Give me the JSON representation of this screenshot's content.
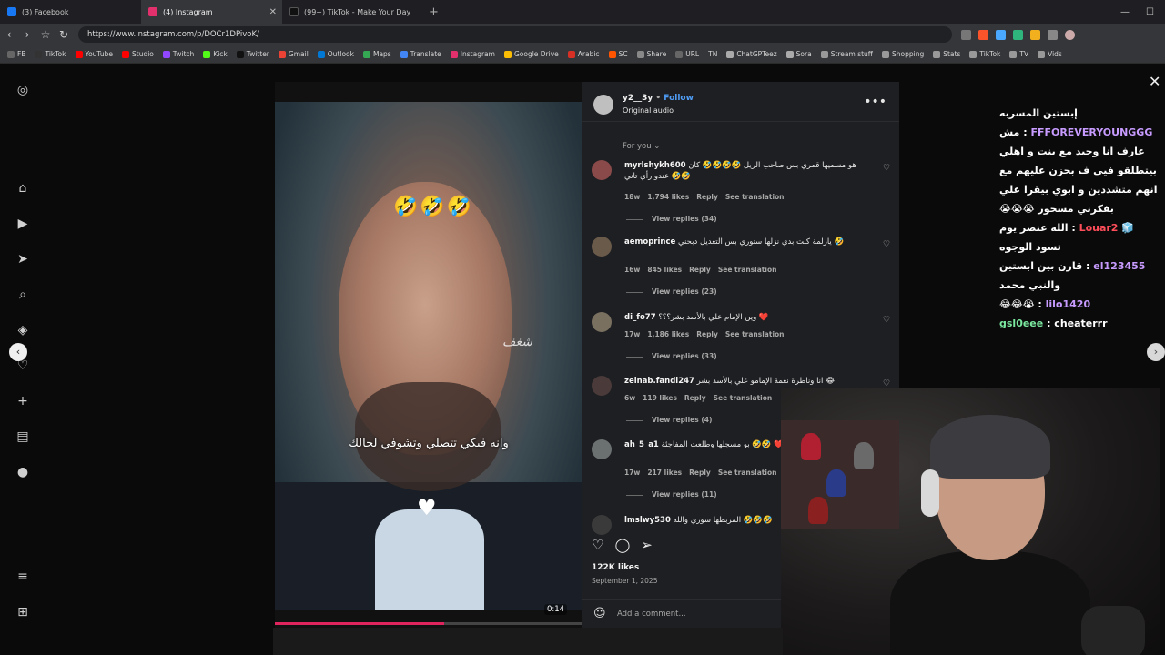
{
  "browser": {
    "tabs": [
      {
        "label": "(3) Facebook",
        "color": "#1877f2",
        "active": false
      },
      {
        "label": "(4) Instagram",
        "color": "#e1306c",
        "active": true
      },
      {
        "label": "(99+) TikTok - Make Your Day",
        "color": "#111111",
        "active": false
      }
    ],
    "url": "https://www.instagram.com/p/DOCr1DPivoK/",
    "bookmarks": [
      "FB",
      "TikTok",
      "YouTube",
      "Studio",
      "Twitch",
      "Kick",
      "Twitter",
      "Gmail",
      "Outlook",
      "Maps",
      "Translate",
      "Instagram",
      "Google Drive",
      "Arabic",
      "SC",
      "Share",
      "URL",
      "TN",
      "ChatGPTeez",
      "Sora",
      "Stream stuff",
      "Shopping",
      "Stats",
      "TikTok",
      "TV",
      "Vids"
    ]
  },
  "post": {
    "username": "y2__3y",
    "follow_label": "Follow",
    "audio": "Original audio",
    "sort_label": "For you",
    "likes": "122K likes",
    "date": "September 1, 2025",
    "add_comment_placeholder": "Add a comment...",
    "video": {
      "emojis": "🤣🤣🤣",
      "subtitle": "وانه فيكي تتصلي وتشوفي لحالك",
      "signature": "شغف",
      "time": "0:14",
      "progress": 0.55
    }
  },
  "comments": [
    {
      "user": "myrlshykh600",
      "text": "هو مسميها قمري بس صاحب الريل 🤣🤣🤣🤣 كان عندو رأي تاني 🤣🤣",
      "age": "18w",
      "likes": "1,794 likes",
      "reply": "Reply",
      "translate": "See translation",
      "replies": "View replies (34)"
    },
    {
      "user": "aemoprince",
      "text": "يازلمة كنت بدي نزلها ستوري بس التعديل دبحني 🤣",
      "age": "16w",
      "likes": "845 likes",
      "reply": "Reply",
      "translate": "See translation",
      "replies": "View replies (23)"
    },
    {
      "user": "di_fo77",
      "text": "وين الإمام علي بالأسد بشر؟؟؟ ❤️",
      "age": "17w",
      "likes": "1,186 likes",
      "reply": "Reply",
      "translate": "See translation",
      "replies": "View replies (33)"
    },
    {
      "user": "zeinab.fandi247",
      "text": "انا وناطرة نغمة الإمامو علي بالأسد بشر 😂",
      "age": "6w",
      "likes": "119 likes",
      "reply": "Reply",
      "translate": "See translation",
      "replies": "View replies (4)"
    },
    {
      "user": "ah_5_a1",
      "text": "بو مسجلها وطلعت المفاجئة 🤣🤣 ❤️",
      "age": "17w",
      "likes": "217 likes",
      "reply": "Reply",
      "translate": "See translation",
      "replies": "View replies (11)"
    },
    {
      "user": "lmslwy530",
      "text": "المزبطها سوري والله 🤣🤣🤣",
      "age": "",
      "likes": "",
      "reply": "",
      "translate": "",
      "replies": ""
    }
  ],
  "chat": [
    {
      "name": "",
      "text": "إبستين المسربه",
      "color": "#ffffff"
    },
    {
      "name": "FFFOREVERYOUNGGG",
      "text": "مش عارف انا وحيد مع بنت و اهلي بيتطلقو فيي ف بحزن عليهم مع انهم متشددين و ابوي بيقرا علي بفكرني مسحور 😭😭😭",
      "color": "#c79bff"
    },
    {
      "name": "Louar2",
      "text": "الله عنصر يوم تسود الوجوه",
      "color": "#ff4d5a"
    },
    {
      "name": "el123455",
      "text": "قارن بين ابستين والنبي محمد",
      "color": "#c79bff"
    },
    {
      "name": "lilo1420",
      "text": "😭😂😂",
      "color": "#c79bff"
    },
    {
      "name": "gsl0eee",
      "text": "cheaterrr",
      "color": "#7be8a0"
    }
  ]
}
